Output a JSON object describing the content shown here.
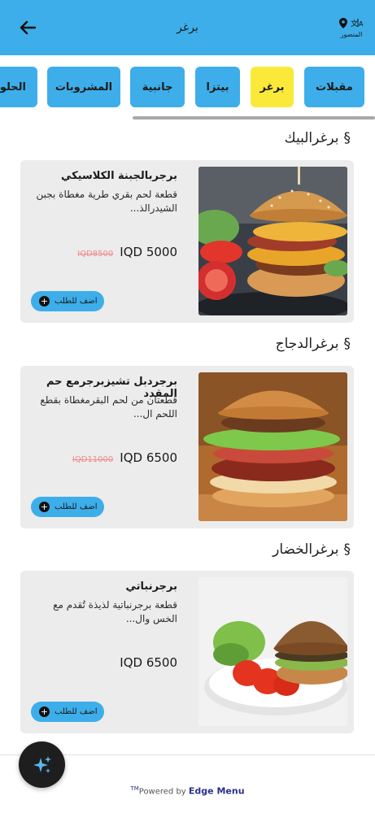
{
  "header": {
    "title": "برغر",
    "location": "المنصور",
    "bg_color": "#3daee9"
  },
  "categories": [
    {
      "label": "مقبلات",
      "active": false
    },
    {
      "label": "برغر",
      "active": true
    },
    {
      "label": "بيتزا",
      "active": false
    },
    {
      "label": "جانبية",
      "active": false
    },
    {
      "label": "المشروبات",
      "active": false
    },
    {
      "label": "الحلو",
      "active": false
    }
  ],
  "sections": [
    {
      "title": "برغرالبيك",
      "mark": "§",
      "item": {
        "name": "برجربالجبنة الكلاسيكي",
        "description": "قطعة لحم بقري طرية مغطاة بجبن الشيدرالذ...",
        "old_price": "IQD8500",
        "price": "IQD 5000",
        "add_label": "اضف للطلب"
      }
    },
    {
      "title": "برغرالدجاج",
      "mark": "§",
      "item": {
        "name": "برجردبل تشيزبرجرمع حم المقدد",
        "description": "قطعتان من لحم البقرمغطاة بقطع اللحم ال...",
        "old_price": "IQD11000",
        "price": "IQD 6500",
        "add_label": "اضف للطلب"
      }
    },
    {
      "title": "برغرالخضار",
      "mark": "§",
      "item": {
        "name": "برجرنباتي",
        "description": "قطعة برجرنباتية لذيذة تُقدم مع الخس وال...",
        "old_price": "",
        "price": "IQD 6500",
        "add_label": "اضف للطلب"
      }
    }
  ],
  "footer": {
    "powered_prefix": "Powered by",
    "brand": "Edge Menu",
    "tm": "TM"
  },
  "colors": {
    "accent": "#3daee9",
    "active_category": "#fbe93a",
    "card_bg": "#ececec",
    "old_price": "#f08a8a"
  }
}
